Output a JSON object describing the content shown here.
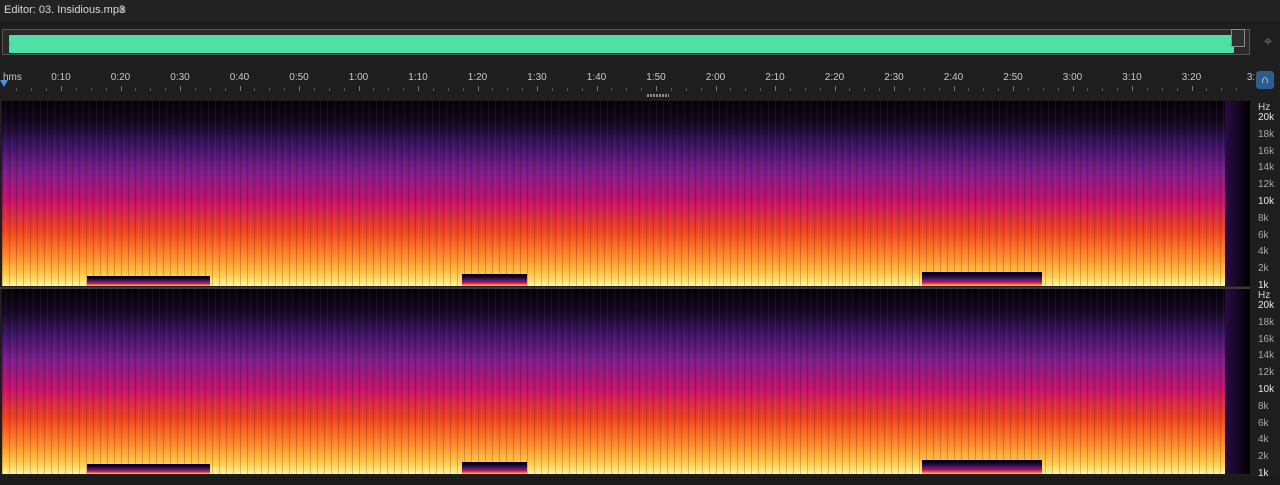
{
  "editor": {
    "title": "Editor: 03. Insidious.mp3",
    "menu_icon": "hamburger-menu-icon"
  },
  "overview": {
    "wave_color": "#4fe0a8",
    "zoom_icon": "zoom-fit-icon"
  },
  "ruler": {
    "labels": [
      "hms",
      "0:10",
      "0:20",
      "0:30",
      "0:40",
      "0:50",
      "1:00",
      "1:10",
      "1:20",
      "1:30",
      "1:40",
      "1:50",
      "2:00",
      "2:10",
      "2:20",
      "2:30",
      "2:40",
      "2:50",
      "3:00",
      "3:10",
      "3:20",
      "3:"
    ],
    "playhead_color": "#4a90e2",
    "snap_icon": "magnet-snap-icon"
  },
  "spectral": {
    "unit": "Hz",
    "scale": [
      "20k",
      "18k",
      "16k",
      "14k",
      "12k",
      "10k",
      "8k",
      "6k",
      "4k",
      "2k",
      "1k"
    ]
  }
}
